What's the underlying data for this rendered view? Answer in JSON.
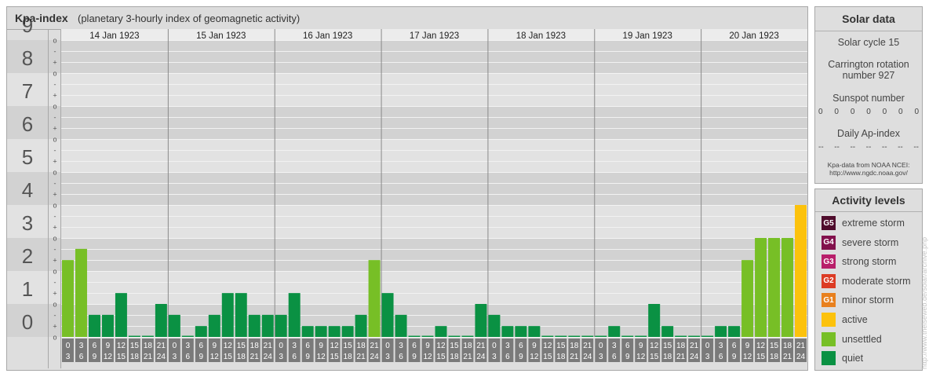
{
  "header": {
    "title": "Kpa-index",
    "subtitle": "(planetary 3-hourly index of geomagnetic activity)"
  },
  "chart_data": {
    "type": "bar",
    "title": "Kpa-index",
    "subtitle": "(planetary 3-hourly index of geomagnetic activity)",
    "ylim": [
      0,
      9
    ],
    "y_ticks": [
      "0",
      "1",
      "2",
      "3",
      "4",
      "5",
      "6",
      "7",
      "8",
      "9"
    ],
    "minor_ticks": [
      "o",
      "+",
      "-"
    ],
    "days": [
      "14 Jan 1923",
      "15 Jan 1923",
      "16 Jan 1923",
      "17 Jan 1923",
      "18 Jan 1923",
      "19 Jan 1923",
      "20 Jan 1923"
    ],
    "interval_labels": [
      [
        "0",
        "3"
      ],
      [
        "3",
        "6"
      ],
      [
        "6",
        "9"
      ],
      [
        "9",
        "12"
      ],
      [
        "12",
        "15"
      ],
      [
        "15",
        "18"
      ],
      [
        "18",
        "21"
      ],
      [
        "21",
        "24"
      ]
    ],
    "values": [
      [
        2.33,
        2.67,
        0.67,
        0.67,
        1.33,
        0,
        0,
        1
      ],
      [
        0.67,
        0,
        0.33,
        0.67,
        1.33,
        1.33,
        0.67,
        0.67
      ],
      [
        0.67,
        1.33,
        0.33,
        0.33,
        0.33,
        0.33,
        0.67,
        2.33
      ],
      [
        1.33,
        0.67,
        0,
        0,
        0.33,
        0,
        0,
        1
      ],
      [
        0.67,
        0.33,
        0.33,
        0.33,
        0,
        0,
        0,
        0
      ],
      [
        0,
        0.33,
        0,
        0,
        1,
        0.33,
        0,
        0
      ],
      [
        0,
        0.33,
        0.33,
        2.33,
        3,
        3,
        3,
        4
      ]
    ],
    "level_colors": {
      "quiet": "#0a9143",
      "unsettled": "#77bf26",
      "active": "#fcc20c"
    },
    "grid": true
  },
  "solar": {
    "title": "Solar data",
    "cycle": "Solar cycle 15",
    "carrington_line1": "Carrington rotation",
    "carrington_line2": "number 927",
    "sunspot_label": "Sunspot number",
    "sunspot_values": [
      "0",
      "0",
      "0",
      "0",
      "0",
      "0",
      "0"
    ],
    "ap_label": "Daily Ap-index",
    "ap_values": [
      "--",
      "--",
      "--",
      "--",
      "--",
      "--",
      "--"
    ],
    "source_line1": "Kpa-data from NOAA NCEI:",
    "source_line2": "http://www.ngdc.noaa.gov/"
  },
  "activity": {
    "title": "Activity levels",
    "items": [
      {
        "badge": "G5",
        "label": "extreme storm",
        "color": "#4f0c2c"
      },
      {
        "badge": "G4",
        "label": "severe storm",
        "color": "#82104c"
      },
      {
        "badge": "G3",
        "label": "strong storm",
        "color": "#b81f6a"
      },
      {
        "badge": "G2",
        "label": "moderate storm",
        "color": "#dc3b24"
      },
      {
        "badge": "G1",
        "label": "minor storm",
        "color": "#e8801e"
      },
      {
        "badge": "",
        "label": "active",
        "color": "#fcc20c"
      },
      {
        "badge": "",
        "label": "unsettled",
        "color": "#77bf26"
      },
      {
        "badge": "",
        "label": "quiet",
        "color": "#0a9143"
      }
    ]
  },
  "watermark": "http://www.theiseweb.de/solar/archive.php"
}
